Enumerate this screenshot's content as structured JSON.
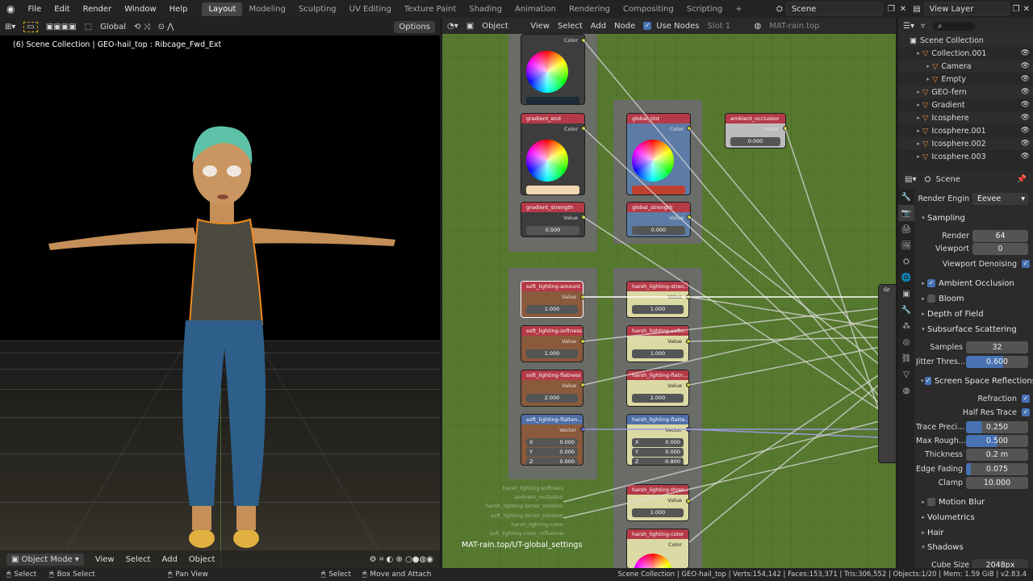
{
  "topbar": {
    "menus": [
      "File",
      "Edit",
      "Render",
      "Window",
      "Help"
    ],
    "workspaces": [
      "Layout",
      "Modeling",
      "Sculpting",
      "UV Editing",
      "Texture Paint",
      "Shading",
      "Animation",
      "Rendering",
      "Compositing",
      "Scripting"
    ],
    "add_tab": "+",
    "scene": "Scene",
    "view_layer": "View Layer"
  },
  "viewport": {
    "orientation": "Global",
    "options": "Options",
    "info": "(6) Scene Collection | GEO-hail_top : Ribcage_Fwd_Ext",
    "mode": "Object Mode",
    "menus": [
      "View",
      "Select",
      "Add",
      "Object"
    ]
  },
  "node_editor": {
    "object": "Object",
    "menus": [
      "View",
      "Select",
      "Add",
      "Node"
    ],
    "use_nodes": "Use Nodes",
    "slot": "Slot 1",
    "material": "MAT-rain.top",
    "breadcrumb": "MAT-rain.top/UT-global_settings",
    "nodes": {
      "gradient_start_out": "Color",
      "gradient_end": {
        "title": "gradient_end",
        "out": "Color"
      },
      "gradient_strength": {
        "title": "gradient_strength",
        "out": "Value",
        "value": "0.500"
      },
      "global_tint": {
        "title": "global_tint",
        "out": "Color"
      },
      "global_strength": {
        "title": "global_strength",
        "out": "Value",
        "value": "0.000"
      },
      "ambient_occlusion": {
        "title": "ambient_occlusion",
        "out": "Value",
        "value": "0.000"
      },
      "soft_amount": {
        "title": "soft_lighting-amount",
        "out": "Value",
        "value": "1.000"
      },
      "soft_softness": {
        "title": "soft_lighting-softness",
        "out": "Value",
        "value": "1.000"
      },
      "soft_flatness": {
        "title": "soft_lighting-flatness",
        "out": "Value",
        "value": "2.000"
      },
      "soft_flatten": {
        "title": "soft_lighting-flatten...",
        "out": "Vector",
        "x": "0.000",
        "y": "0.000",
        "z": "0.000"
      },
      "harsh_strength": {
        "title": "harsh_lighting-stren...",
        "out": "Value",
        "value": "1.000"
      },
      "harsh_softness": {
        "title": "harsh_lighting-softn...",
        "out": "Value",
        "value": "1.000"
      },
      "harsh_flatness": {
        "title": "harsh_lighting-flatn...",
        "out": "Value",
        "value": "2.000"
      },
      "harsh_flatten": {
        "title": "harsh_lighting-flatte...",
        "out": "Vector",
        "x": "0.000",
        "y": "0.000",
        "z": "-0.800"
      },
      "harsh_thresh": {
        "title": "harsh_lighting-thres...",
        "out": "Value",
        "value": "1.000"
      },
      "harsh_color": {
        "title": "harsh_lighting-color",
        "out": "Color"
      },
      "group_input_labels": [
        "harsh_lighting-softness",
        "ambient_occlusion",
        "harsh_lighting-factor_rotation",
        "soft_lighting-factor_rotation",
        "harsh_lighting-color",
        "soft_lighting-color_influence"
      ]
    }
  },
  "outliner": {
    "root": "Scene Collection",
    "items": [
      {
        "label": "Collection.001",
        "indent": 1
      },
      {
        "label": "Camera",
        "indent": 2
      },
      {
        "label": "Empty",
        "indent": 2
      },
      {
        "label": "GEO-fern",
        "indent": 1
      },
      {
        "label": "Gradient",
        "indent": 1
      },
      {
        "label": "Icosphere",
        "indent": 1
      },
      {
        "label": "Icosphere.001",
        "indent": 1
      },
      {
        "label": "Icosphere.002",
        "indent": 1
      },
      {
        "label": "Icosphere.003",
        "indent": 1
      }
    ]
  },
  "properties": {
    "context": "Scene",
    "render_engine_label": "Render Engin",
    "render_engine": "Eevee",
    "sampling": "Sampling",
    "render_label": "Render",
    "render_value": "64",
    "viewport_label": "Viewport",
    "viewport_value": "0",
    "viewport_denoising": "Viewport Denoising",
    "ambient_occlusion": "Ambient Occlusion",
    "bloom": "Bloom",
    "depth_of_field": "Depth of Field",
    "sss": "Subsurface Scattering",
    "samples_label": "Samples",
    "samples_value": "32",
    "jitter_label": "Jitter Thres...",
    "jitter_value": "0.600",
    "ssr": "Screen Space Reflections",
    "refraction": "Refraction",
    "half_res": "Half Res Trace",
    "trace_label": "Trace Preci...",
    "trace_value": "0.250",
    "rough_label": "Max Rough...",
    "rough_value": "0.500",
    "thickness_label": "Thickness",
    "thickness_value": "0.2 m",
    "edge_label": "Edge Fading",
    "edge_value": "0.075",
    "clamp_label": "Clamp",
    "clamp_value": "10.000",
    "motion_blur": "Motion Blur",
    "volumetrics": "Volumetrics",
    "hair": "Hair",
    "shadows": "Shadows",
    "cube_size_label": "Cube Size",
    "cube_size_value": "2048px"
  },
  "statusbar": {
    "select": "Select",
    "box_select": "Box Select",
    "pan_view": "Pan View",
    "select2": "Select",
    "move_attach": "Move and Attach",
    "stats": "Scene Collection | GEO-hail_top | Verts:154,142 | Faces:153,371 | Tris:306,552 | Objects:1/20 | Mem: 1.59 GiB | v2.83.4"
  }
}
